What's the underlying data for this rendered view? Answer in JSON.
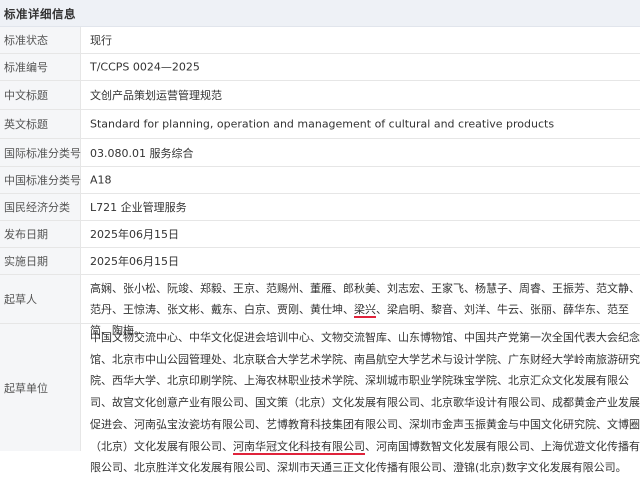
{
  "header": {
    "title": "标准详细信息"
  },
  "rows": {
    "status": {
      "label": "标准状态",
      "value": "现行"
    },
    "number": {
      "label": "标准编号",
      "value": "T/CCPS 0024—2025"
    },
    "cn_title": {
      "label": "中文标题",
      "value": "文创产品策划运营管理规范"
    },
    "en_title": {
      "label": "英文标题",
      "value": "Standard for planning, operation and management of cultural and creative products"
    },
    "ics": {
      "label": "国际标准分类号",
      "value": "03.080.01 服务综合"
    },
    "ccs": {
      "label": "中国标准分类号",
      "value": "A18"
    },
    "nec": {
      "label": "国民经济分类",
      "value": "L721 企业管理服务"
    },
    "publish": {
      "label": "发布日期",
      "value": "2025年06月15日"
    },
    "implement": {
      "label": "实施日期",
      "value": "2025年06月15日"
    }
  },
  "drafters": {
    "label": "起草人",
    "before": "高娴、张小松、阮竣、郑毅、王京、范赐州、董雁、郎秋美、刘志宏、王家飞、杨慧子、周睿、王振芳、范文静、范丹、王惊涛、张文彬、戴东、白京、贾刚、黄仕坤、",
    "highlight": "梁兴",
    "after": "、梁启明、黎音、刘洋、牛云、张丽、薛华东、范至简、陶梅。"
  },
  "units": {
    "label": "起草单位",
    "before": "中国文物交流中心、中华文化促进会培训中心、文物交流智库、山东博物馆、中国共产党第一次全国代表大会纪念馆、北京市中山公园管理处、北京联合大学艺术学院、南昌航空大学艺术与设计学院、广东财经大学岭南旅游研究院、西华大学、北京印刷学院、上海农林职业技术学院、深圳城市职业学院珠宝学院、北京汇众文化发展有限公司、故宫文化创意产业有限公司、国文策（北京）文化发展有限公司、北京歌华设计有限公司、成都黄金产业发展促进会、河南弘宝汝瓷坊有限公司、艺博教育科技集团有限公司、深圳市金声玉振黄金与中国文化研究院、文博圈（北京）文化发展有限公司、",
    "highlight": "河南华冠文化科技有限公司",
    "after": "、河南国博数智文化发展有限公司、上海优遊文化传播有限公司、北京胜洋文化发展有限公司、深圳市天通三正文化传播有限公司、澄锦(北京)数字文化发展有限公司。"
  },
  "colors": {
    "accent_underline": "#e0233b",
    "label_bg": "#f5f6f8",
    "header_bg": "#eef1f6"
  }
}
